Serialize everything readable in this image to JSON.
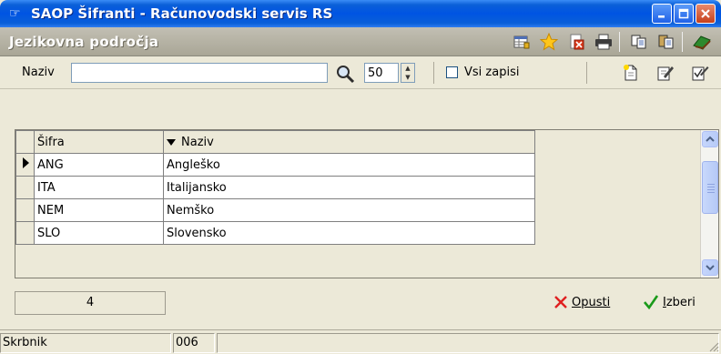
{
  "window": {
    "title": "SAOP Šifranti - Računovodski servis RS"
  },
  "section": {
    "title": "Jezikovna področja",
    "toolbar_icons": [
      "grid-settings-icon",
      "favorite-star-icon",
      "close-doc-icon",
      "print-icon",
      "copy-icon",
      "paste-icon",
      "exit-icon"
    ]
  },
  "search": {
    "label": "Naziv",
    "value": "",
    "count": "50",
    "all_records_label": "Vsi zapisi",
    "all_records_checked": false,
    "action_icons": [
      "new-document-icon",
      "edit-icon",
      "edit-check-icon"
    ]
  },
  "grid": {
    "columns": [
      "Šifra",
      "Naziv"
    ],
    "sorted_column": "Naziv",
    "rows": [
      {
        "sifra": "ANG",
        "naziv": "Angleško"
      },
      {
        "sifra": "ITA",
        "naziv": "Italijansko"
      },
      {
        "sifra": "NEM",
        "naziv": "Nemško"
      },
      {
        "sifra": "SLO",
        "naziv": "Slovensko"
      }
    ],
    "current_row": 0
  },
  "footer": {
    "record_count": "4",
    "cancel_label_accel": "O",
    "cancel_label_rest": "pusti",
    "select_label_accel": "I",
    "select_label_rest": "zberi"
  },
  "status": {
    "user": "Skrbnik",
    "code": "006"
  },
  "colors": {
    "title_bar": "#0054e3",
    "header_highlight": "#00ffff",
    "cancel_icon": "#e02020",
    "select_icon": "#1a9a1a"
  }
}
